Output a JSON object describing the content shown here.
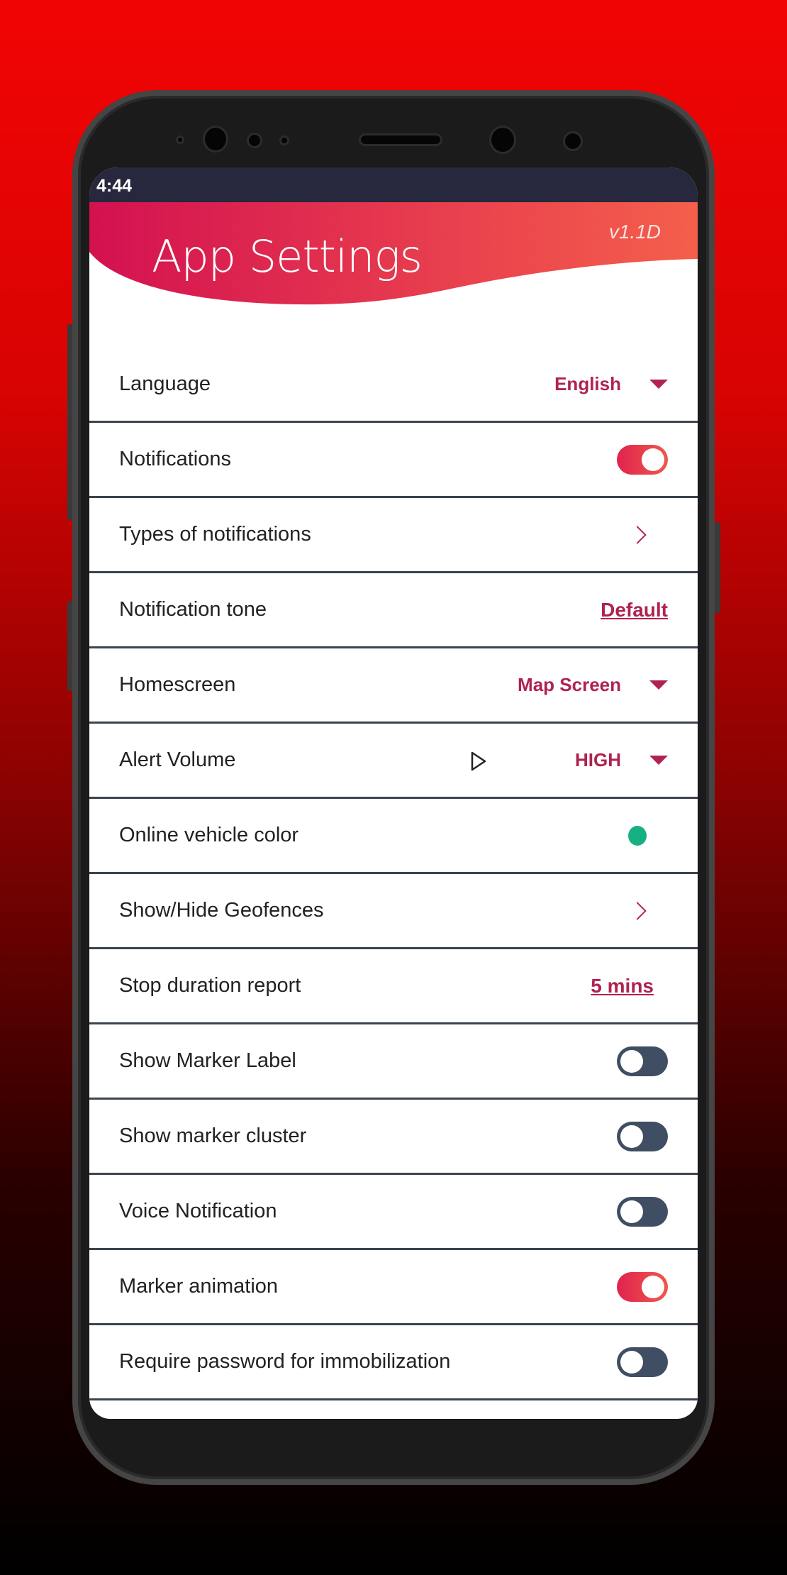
{
  "status_bar": {
    "time": "4:44"
  },
  "header": {
    "title": "App Settings",
    "version": "v1.1D"
  },
  "colors": {
    "accent": "#b0234f",
    "toggle_on": "#e0234f",
    "toggle_off": "#3f4e62",
    "online_vehicle": "#17b082"
  },
  "settings": [
    {
      "label": "Language",
      "type": "dropdown",
      "value": "English"
    },
    {
      "label": "Notifications",
      "type": "toggle",
      "on": true
    },
    {
      "label": "Types of notifications",
      "type": "chevron"
    },
    {
      "label": "Notification tone",
      "type": "link",
      "value": "Default"
    },
    {
      "label": "Homescreen",
      "type": "dropdown",
      "value": "Map Screen"
    },
    {
      "label": "Alert Volume",
      "type": "dropdown",
      "value": "HIGH",
      "icon": "play-icon"
    },
    {
      "label": "Online vehicle color",
      "type": "color"
    },
    {
      "label": "Show/Hide Geofences",
      "type": "chevron"
    },
    {
      "label": "Stop duration report",
      "type": "link",
      "value": "5 mins"
    },
    {
      "label": "Show Marker Label",
      "type": "toggle",
      "on": false
    },
    {
      "label": "Show marker cluster",
      "type": "toggle",
      "on": false
    },
    {
      "label": "Voice Notification",
      "type": "toggle",
      "on": false
    },
    {
      "label": "Marker animation",
      "type": "toggle",
      "on": true
    },
    {
      "label": "Require password for immobilization",
      "type": "toggle",
      "on": false
    }
  ]
}
